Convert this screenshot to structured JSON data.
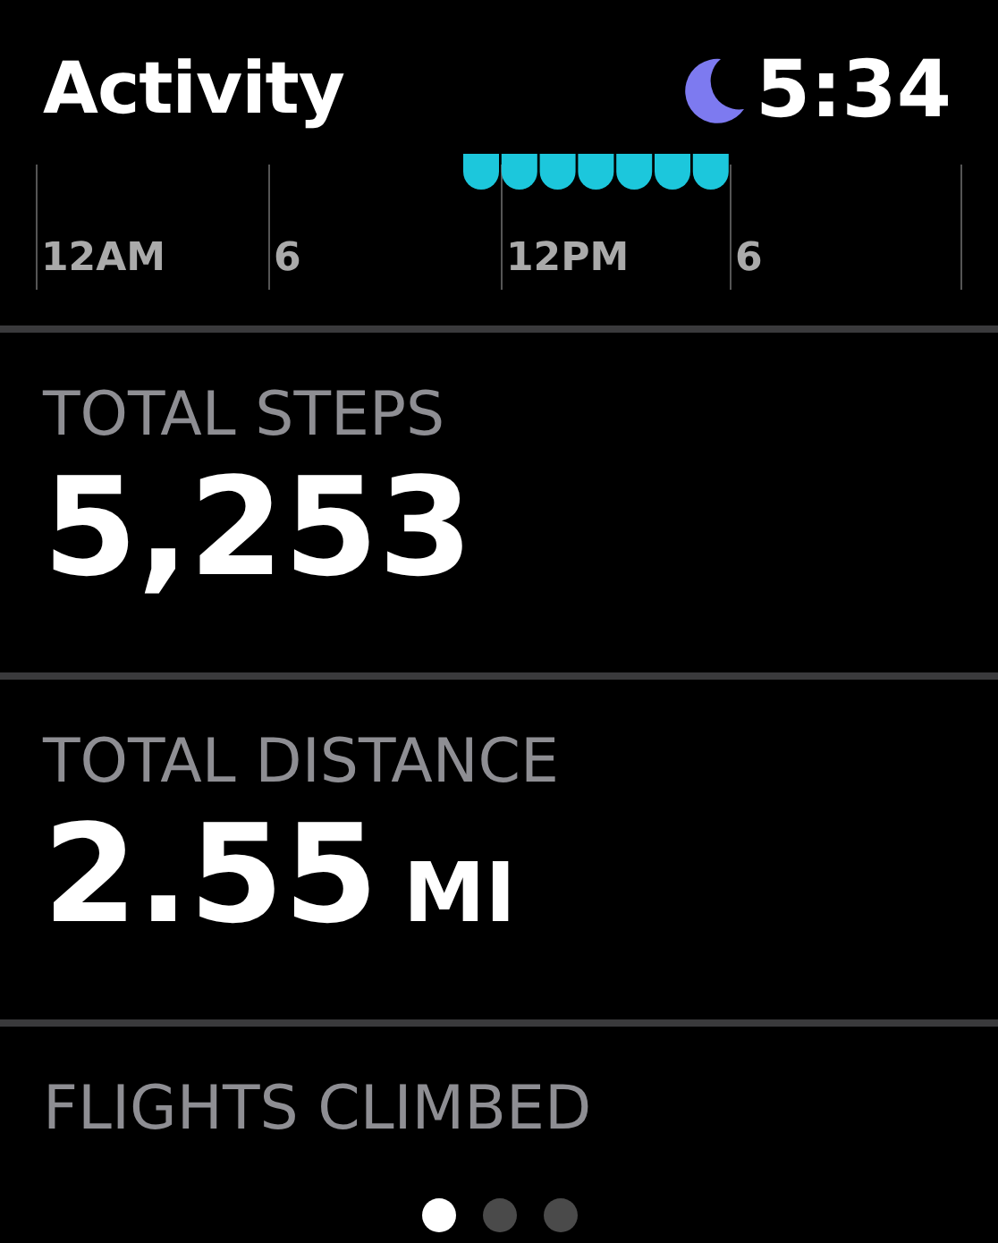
{
  "header": {
    "title": "Activity",
    "time": "5:34",
    "moon": true
  },
  "timeline": {
    "labels": [
      "12AM",
      "6",
      "12PM",
      "6"
    ]
  },
  "metrics": [
    {
      "label": "TOTAL STEPS",
      "value": "5,253"
    },
    {
      "label": "TOTAL DISTANCE",
      "value": "2.55",
      "unit": "MI"
    },
    {
      "label": "FLIGHTS CLIMBED"
    }
  ],
  "page_dots": [
    {
      "selected": true
    },
    {
      "selected": false
    },
    {
      "selected": false
    }
  ]
}
